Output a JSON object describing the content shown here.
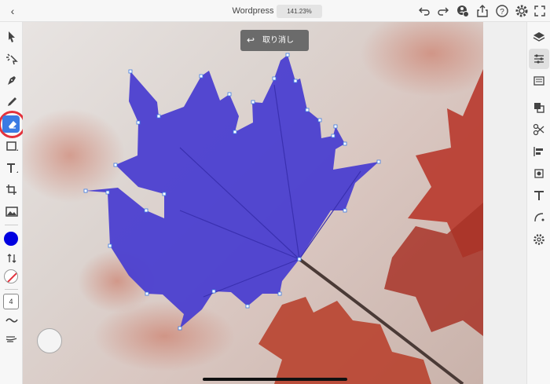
{
  "header": {
    "back_icon": "chevron-left-icon",
    "title": "Wordpress",
    "zoom": "141.23%",
    "icons": [
      "undo-icon",
      "redo-icon",
      "add-user-icon",
      "share-icon",
      "help-icon",
      "gear-icon",
      "fullscreen-icon"
    ]
  },
  "toast": {
    "icon": "undo-icon",
    "label": "取り消し"
  },
  "left_tools": [
    "selection-icon",
    "direct-selection-icon",
    "pen-icon",
    "pencil-icon",
    "eraser-icon",
    "rectangle-icon",
    "text-icon",
    "crop-icon",
    "image-icon"
  ],
  "stroke_width": "4",
  "colors": {
    "fill": "#0000e0",
    "accent": "#3b7be3",
    "highlight_ring": "#e3323c",
    "leaf": "#4b3fd0"
  },
  "right_tools": [
    "layers-icon",
    "properties-icon",
    "libraries-icon",
    "path-icon",
    "scissors-icon",
    "align-icon",
    "transform-icon",
    "type-icon",
    "curve-icon",
    "settings-icon"
  ]
}
